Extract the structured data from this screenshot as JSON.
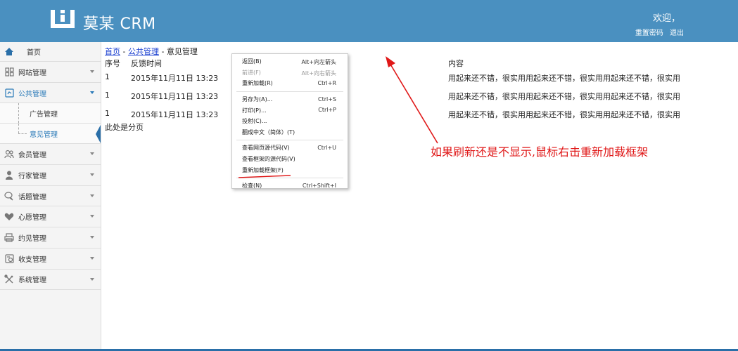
{
  "header": {
    "brand": "莫某 CRM",
    "welcome": "欢迎，",
    "reset_password": "重置密码",
    "logout": "退出",
    "bg_color": "#4a90c0"
  },
  "sidebar": {
    "home": "首页",
    "items": [
      {
        "label": "网站管理",
        "icon": "grid-icon"
      },
      {
        "label": "公共管理",
        "icon": "share-icon",
        "active": true
      },
      {
        "label": "会员管理",
        "icon": "users-icon"
      },
      {
        "label": "行家管理",
        "icon": "user-icon"
      },
      {
        "label": "话题管理",
        "icon": "chat-icon"
      },
      {
        "label": "心愿管理",
        "icon": "heart-icon"
      },
      {
        "label": "约见管理",
        "icon": "printer-icon"
      },
      {
        "label": "收支管理",
        "icon": "finance-icon"
      },
      {
        "label": "系统管理",
        "icon": "tools-icon"
      }
    ],
    "sub_items": [
      "广告管理",
      "意见管理"
    ]
  },
  "content": {
    "breadcrumb": {
      "home": "首页",
      "sep1": " - ",
      "section": "公共管理",
      "sep2": " - ",
      "current": "意见管理"
    },
    "columns": [
      "序号",
      "反馈时间",
      "内容"
    ],
    "rows": [
      [
        "1",
        "2015年11月11日 13:23",
        "用起来还不错，很实用用起来还不错，很实用用起来还不错，很实用"
      ],
      [
        "1",
        "2015年11月11日 13:23",
        "用起来还不错，很实用用起来还不错，很实用用起来还不错，很实用"
      ],
      [
        "1",
        "2015年11月11日 13:23",
        "用起来还不错，很实用用起来还不错，很实用用起来还不错，很实用"
      ]
    ],
    "paging": "此处是分页"
  },
  "context_menu": {
    "items": [
      {
        "label": "返回(B)",
        "shortcut": "Alt+向左箭头"
      },
      {
        "label": "前进(F)",
        "shortcut": "Alt+向右箭头",
        "disabled": true
      },
      {
        "label": "重新加载(R)",
        "shortcut": "Ctrl+R"
      },
      {
        "label": "另存为(A)...",
        "shortcut": "Ctrl+S"
      },
      {
        "label": "打印(P)...",
        "shortcut": "Ctrl+P"
      },
      {
        "label": "投射(C)...",
        "shortcut": ""
      },
      {
        "label": "翻成中文（简体）(T)",
        "shortcut": ""
      },
      {
        "label": "查看网页源代码(V)",
        "shortcut": "Ctrl+U"
      },
      {
        "label": "查看框架的源代码(V)",
        "shortcut": ""
      },
      {
        "label": "重新加载框架(F)",
        "shortcut": ""
      },
      {
        "label": "检查(N)",
        "shortcut": "Ctrl+Shift+I"
      }
    ]
  },
  "annotation": {
    "text": "如果刷新还是不显示,鼠标右击重新加载框架",
    "color": "#e01818"
  }
}
